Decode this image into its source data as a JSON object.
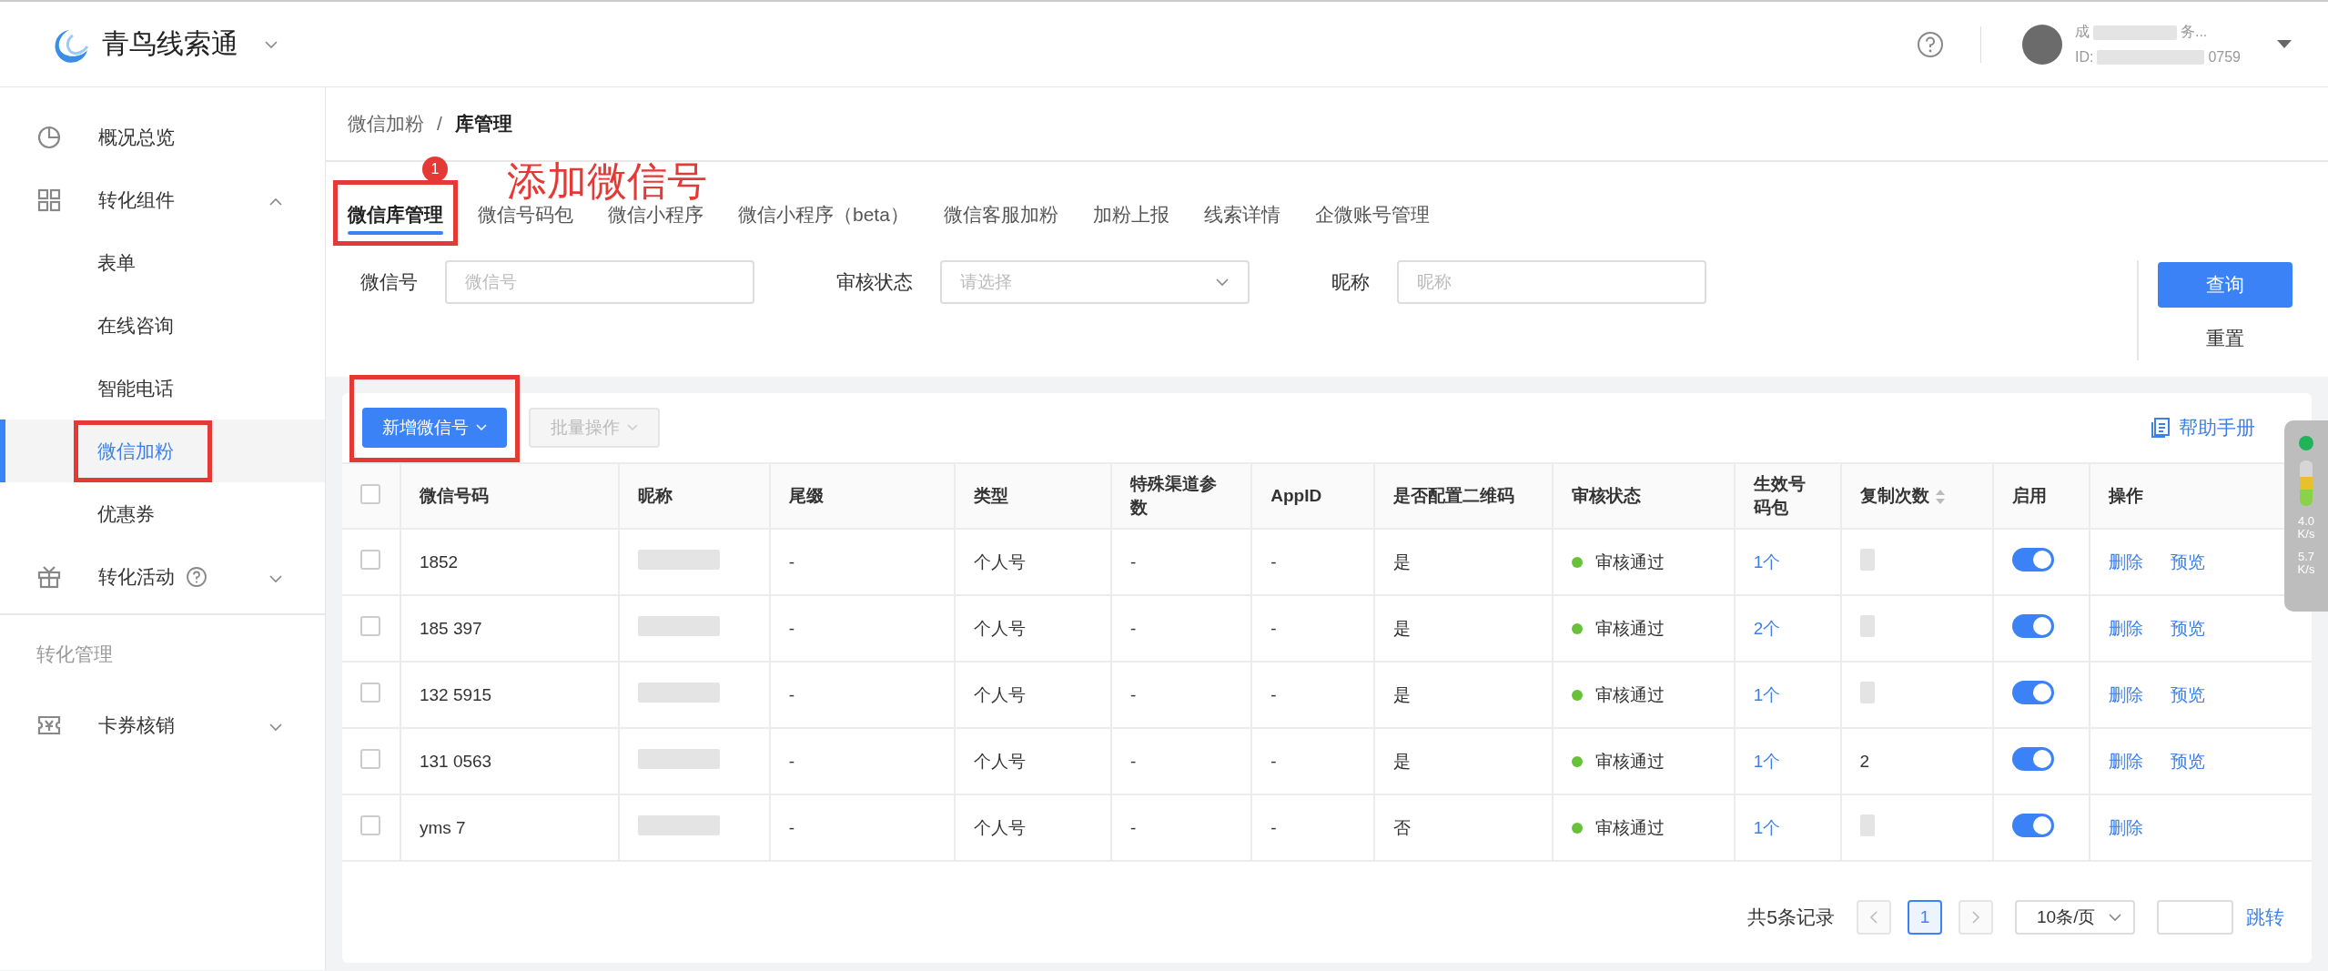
{
  "header": {
    "app_name": "青鸟线索通",
    "user": {
      "name_start": "成",
      "name_end": "务...",
      "id_label": "ID:",
      "id_tail": "0759"
    }
  },
  "sidebar": {
    "items": [
      {
        "kind": "item",
        "label": "概况总览",
        "selected": false,
        "highlighted": false
      },
      {
        "kind": "group",
        "label": "转化组件",
        "expanded": true,
        "children": [
          {
            "label": "表单",
            "selected": false,
            "highlighted": false
          },
          {
            "label": "在线咨询",
            "selected": false,
            "highlighted": false
          },
          {
            "label": "智能电话",
            "selected": false,
            "highlighted": false
          },
          {
            "label": "微信加粉",
            "selected": true,
            "highlighted": true
          },
          {
            "label": "优惠券",
            "selected": false,
            "highlighted": false
          }
        ]
      },
      {
        "kind": "group",
        "label": "转化活动",
        "expanded": false,
        "help": true
      },
      {
        "kind": "section",
        "label": "转化管理"
      },
      {
        "kind": "group",
        "label": "卡券核销",
        "expanded": false
      }
    ]
  },
  "breadcrumb": {
    "items": [
      "微信加粉",
      "库管理"
    ],
    "separator": "/"
  },
  "annotation": {
    "badge": "1",
    "text": "添加微信号"
  },
  "tabs": [
    {
      "label": "微信库管理",
      "selected": true,
      "highlighted": true
    },
    {
      "label": "微信号码包",
      "selected": false,
      "highlighted": false
    },
    {
      "label": "微信小程序",
      "selected": false,
      "highlighted": false
    },
    {
      "label": "微信小程序（beta）",
      "selected": false,
      "highlighted": false
    },
    {
      "label": "微信客服加粉",
      "selected": false,
      "highlighted": false
    },
    {
      "label": "加粉上报",
      "selected": false,
      "highlighted": false
    },
    {
      "label": "线索详情",
      "selected": false,
      "highlighted": false
    },
    {
      "label": "企微账号管理",
      "selected": false,
      "highlighted": false
    }
  ],
  "filters": [
    {
      "kind": "input",
      "label": "微信号",
      "placeholder": "微信号"
    },
    {
      "kind": "select",
      "label": "审核状态",
      "placeholder": "请选择"
    },
    {
      "kind": "input",
      "label": "昵称",
      "placeholder": "昵称"
    }
  ],
  "filter_buttons": [
    {
      "kind": "primary",
      "label": "查询"
    },
    {
      "kind": "text",
      "label": "重置"
    }
  ],
  "toolbar": {
    "buttons": [
      {
        "label": "新增微信号",
        "kind": "primary",
        "disabled": false,
        "highlighted": true
      },
      {
        "label": "批量操作",
        "kind": "default",
        "disabled": true,
        "highlighted": false
      }
    ],
    "help_link": "帮助手册"
  },
  "table": {
    "all_checked": false,
    "columns": [
      {
        "label": "微信号码"
      },
      {
        "label": "昵称"
      },
      {
        "label": "尾缀"
      },
      {
        "label": "类型"
      },
      {
        "label": "特殊渠道参数"
      },
      {
        "label": "AppID"
      },
      {
        "label": "是否配置二维码"
      },
      {
        "label": "审核状态"
      },
      {
        "label": "生效号码包"
      },
      {
        "label": "复制次数",
        "sortable": true
      },
      {
        "label": "启用"
      },
      {
        "label": "操作"
      }
    ],
    "rows": [
      {
        "checked": false,
        "wechat": "1852",
        "suffix": "-",
        "type": "个人号",
        "channel": "-",
        "appid": "-",
        "qr": "是",
        "status": "审核通过",
        "color": "#67c23a",
        "package": "1个",
        "enabled": true,
        "actions": [
          "删除",
          "预览"
        ]
      },
      {
        "checked": false,
        "wechat": "185 397",
        "suffix": "-",
        "type": "个人号",
        "channel": "-",
        "appid": "-",
        "qr": "是",
        "status": "审核通过",
        "color": "#67c23a",
        "package": "2个",
        "enabled": true,
        "actions": [
          "删除",
          "预览"
        ]
      },
      {
        "checked": false,
        "wechat": "132 5915",
        "suffix": "-",
        "type": "个人号",
        "channel": "-",
        "appid": "-",
        "qr": "是",
        "status": "审核通过",
        "color": "#67c23a",
        "package": "1个",
        "enabled": true,
        "actions": [
          "删除",
          "预览"
        ]
      },
      {
        "checked": false,
        "wechat": "131 0563",
        "suffix": "-",
        "type": "个人号",
        "channel": "-",
        "appid": "-",
        "qr": "是",
        "status": "审核通过",
        "color": "#67c23a",
        "package": "1个",
        "copies": "2",
        "enabled": true,
        "actions": [
          "删除",
          "预览"
        ]
      },
      {
        "checked": false,
        "wechat": "yms 7",
        "suffix": "-",
        "type": "个人号",
        "channel": "-",
        "appid": "-",
        "qr": "否",
        "status": "审核通过",
        "color": "#67c23a",
        "package": "1个",
        "enabled": true,
        "actions": [
          "删除"
        ]
      }
    ]
  },
  "pagination": {
    "total": "共5条记录",
    "pages": [
      {
        "label": "1",
        "selected": true
      }
    ],
    "page_size": "10条/页",
    "jump": "跳转"
  },
  "speed_widget": {
    "up": "4.0",
    "up_unit": "K/s",
    "down": "5.7",
    "down_unit": "K/s"
  }
}
